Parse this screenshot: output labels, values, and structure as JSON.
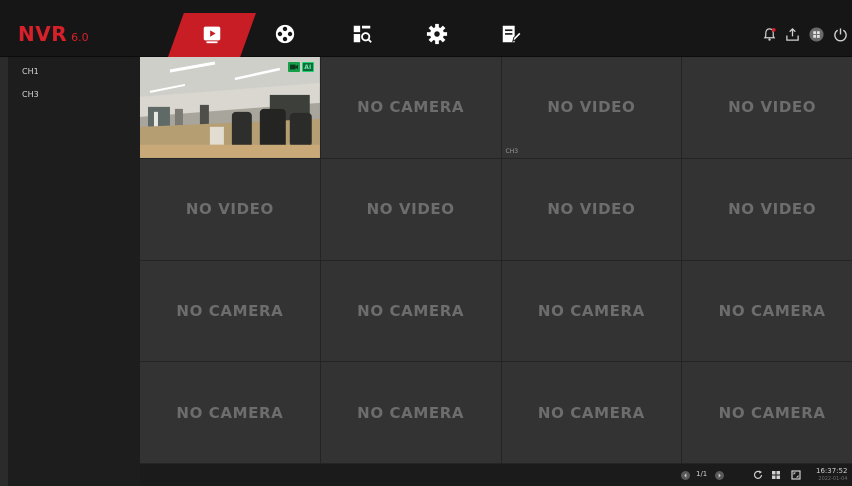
{
  "brand": {
    "name": "NVR",
    "version": "6.0"
  },
  "nav": [
    {
      "id": "live-view",
      "icon": "play-icon",
      "active": true
    },
    {
      "id": "playback",
      "icon": "film-reel-icon",
      "active": false
    },
    {
      "id": "search",
      "icon": "search-grid-icon",
      "active": false
    },
    {
      "id": "settings",
      "icon": "gear-icon",
      "active": false
    },
    {
      "id": "maintenance",
      "icon": "edit-document-icon",
      "active": false
    }
  ],
  "utilities": [
    {
      "id": "alarm",
      "icon": "bell-alert-icon"
    },
    {
      "id": "backup",
      "icon": "export-icon"
    },
    {
      "id": "layout",
      "icon": "layout-icon"
    },
    {
      "id": "power",
      "icon": "power-icon"
    }
  ],
  "sidebar": {
    "channels": [
      "CH1",
      "CH3"
    ]
  },
  "grid": {
    "cells": [
      {
        "type": "live",
        "label": ""
      },
      {
        "type": "status",
        "label": "NO CAMERA"
      },
      {
        "type": "status",
        "label": "NO VIDEO",
        "channel": "CH3"
      },
      {
        "type": "status",
        "label": "NO VIDEO"
      },
      {
        "type": "status",
        "label": "NO VIDEO"
      },
      {
        "type": "status",
        "label": "NO VIDEO"
      },
      {
        "type": "status",
        "label": "NO VIDEO"
      },
      {
        "type": "status",
        "label": "NO VIDEO"
      },
      {
        "type": "status",
        "label": "NO CAMERA"
      },
      {
        "type": "status",
        "label": "NO CAMERA"
      },
      {
        "type": "status",
        "label": "NO CAMERA"
      },
      {
        "type": "status",
        "label": "NO CAMERA"
      },
      {
        "type": "status",
        "label": "NO CAMERA"
      },
      {
        "type": "status",
        "label": "NO CAMERA"
      },
      {
        "type": "status",
        "label": "NO CAMERA"
      },
      {
        "type": "status",
        "label": "NO CAMERA"
      }
    ],
    "live_badges": {
      "camera_icon": "video-camera-icon",
      "ai": "AI"
    }
  },
  "bottombar": {
    "page": "1/1",
    "time": "16:37:52",
    "date": "2022-01-04"
  },
  "colors": {
    "accent": "#c81d25",
    "brand": "#d8202a",
    "cell_bg": "#333333",
    "status_text": "#6d6d6d"
  }
}
